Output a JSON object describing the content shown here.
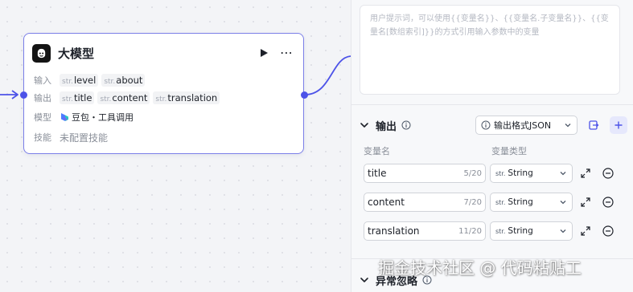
{
  "node": {
    "title": "大模型",
    "input_label": "输入",
    "inputs": [
      {
        "type": "str.",
        "name": "level"
      },
      {
        "type": "str.",
        "name": "about"
      }
    ],
    "output_label": "输出",
    "outputs": [
      {
        "type": "str.",
        "name": "title"
      },
      {
        "type": "str.",
        "name": "content"
      },
      {
        "type": "str.",
        "name": "translation"
      }
    ],
    "model_label": "模型",
    "model_name": "豆包・工具调用",
    "skill_label": "技能",
    "skill_value": "未配置技能"
  },
  "panel": {
    "prompt_placeholder": "用户提示词，可以使用{{变量名}}、{{变量名.子变量名}}、{{变量名[数组索引]}}的方式引用输入参数中的变量",
    "output_section": {
      "title": "输出",
      "format_label": "输出格式JSON",
      "col_name": "变量名",
      "col_type": "变量类型",
      "rows": [
        {
          "name": "title",
          "count": "5/20",
          "type_prefix": "str.",
          "type": "String"
        },
        {
          "name": "content",
          "count": "7/20",
          "type_prefix": "str.",
          "type": "String"
        },
        {
          "name": "translation",
          "count": "11/20",
          "type_prefix": "str.",
          "type": "String"
        }
      ]
    },
    "exception_section": {
      "title": "异常忽略"
    }
  },
  "watermark": "掘金技术社区 @ 代码粘贴工",
  "colors": {
    "accent": "#4d53e8",
    "node_border": "#7b7fe8",
    "panel_bg": "#f7f8fa",
    "canvas_bg": "#f3f4f7"
  },
  "icons": {
    "node": "llm-robot-icon",
    "run": "play-icon",
    "more": "more-dots-icon",
    "model": "doubao-logo-icon",
    "collapse": "chevron-down-icon",
    "info": "info-icon",
    "import": "import-icon",
    "add": "plus-icon",
    "expand": "expand-arrows-icon",
    "remove": "minus-circle-icon"
  }
}
